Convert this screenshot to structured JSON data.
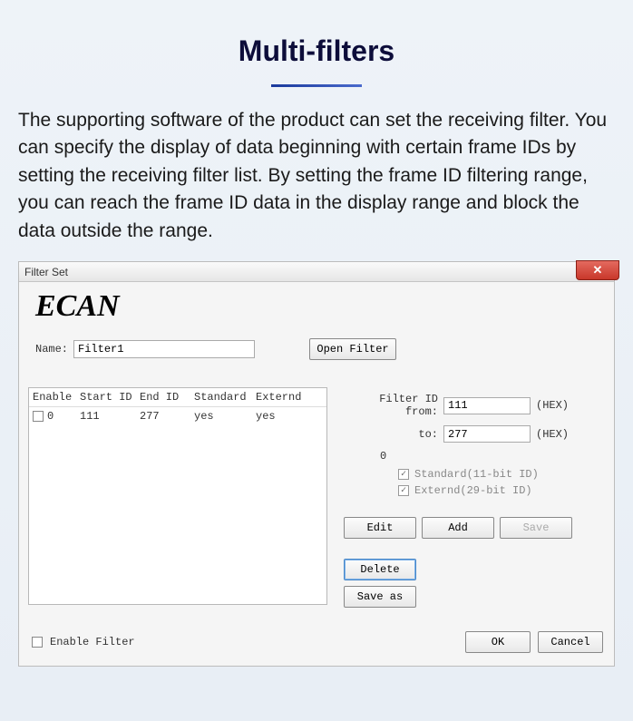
{
  "page": {
    "title": "Multi-filters",
    "description": "The supporting software of the product can set the receiving filter. You can specify the display of data beginning with certain frame IDs by setting the receiving filter list. By setting the frame ID filtering range, you can reach the frame ID data in the display range and block the data outside the range."
  },
  "dialog": {
    "title": "Filter Set",
    "brand": "ECAN",
    "name_label": "Name:",
    "name_value": "Filter1",
    "open_filter": "Open Filter",
    "table": {
      "headers": {
        "enable": "Enable",
        "start": "Start ID",
        "end": "End ID",
        "standard": "Standard",
        "externd": "Externd"
      },
      "row": {
        "enable": "0",
        "start": "111",
        "end": "277",
        "standard": "yes",
        "externd": "yes"
      }
    },
    "form": {
      "filter_from_label": "Filter ID from:",
      "filter_from": "111",
      "to_label": "to:",
      "filter_to": "277",
      "hex": "(HEX)",
      "zero": "0",
      "standard": "Standard(11-bit ID)",
      "externd": "Externd(29-bit ID)"
    },
    "buttons": {
      "edit": "Edit",
      "add": "Add",
      "save": "Save",
      "delete": "Delete",
      "save_as": "Save as",
      "ok": "OK",
      "cancel": "Cancel"
    },
    "enable_filter": "Enable Filter"
  }
}
